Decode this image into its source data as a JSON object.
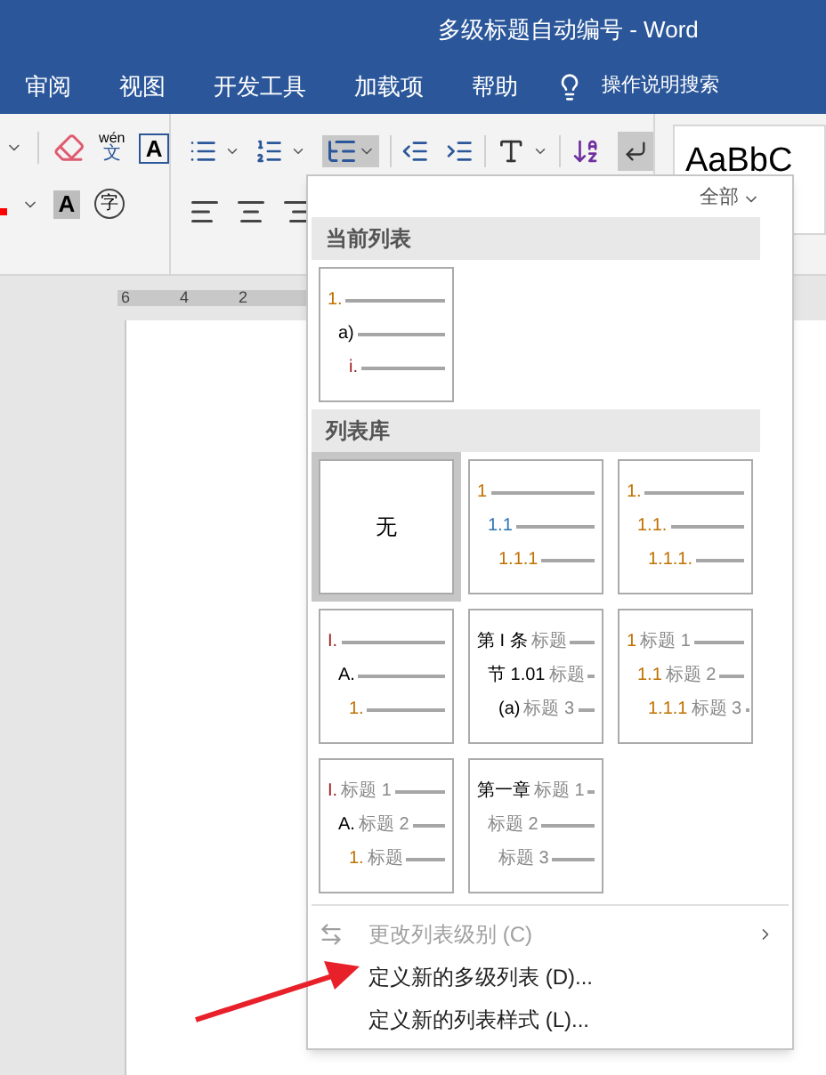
{
  "window": {
    "title": "多级标题自动编号 - Word"
  },
  "tabs": [
    {
      "label": "审阅"
    },
    {
      "label": "视图"
    },
    {
      "label": "开发工具"
    },
    {
      "label": "加载项"
    },
    {
      "label": "帮助"
    }
  ],
  "tell_me": {
    "placeholder": "操作说明搜索"
  },
  "ribbon": {
    "phonetic_top": "wén",
    "phonetic_bottom": "文",
    "border_char": "A",
    "shading_char": "A",
    "enclose_char": "字",
    "multilevel_open": true,
    "show_marks_on": true,
    "style_preview": "AaBbC"
  },
  "ruler": [
    "6",
    "4",
    "2"
  ],
  "menu": {
    "filter": "全部",
    "current_header": "当前列表",
    "current": {
      "levels": [
        {
          "number": "1.",
          "color": "#c07000"
        },
        {
          "number": "a)",
          "color": "#000000"
        },
        {
          "number": "i.",
          "color": "#a02020"
        }
      ]
    },
    "library_header": "列表库",
    "gallery": [
      {
        "kind": "none",
        "text": "无",
        "selected": true
      },
      {
        "kind": "list",
        "selected": false,
        "levels": [
          {
            "number": "1",
            "color": "#c07000"
          },
          {
            "number": "1.1",
            "color": "#2e75b6"
          },
          {
            "number": "1.1.1",
            "color": "#c07000"
          }
        ]
      },
      {
        "kind": "list",
        "selected": false,
        "levels": [
          {
            "number": "1.",
            "color": "#c07000"
          },
          {
            "number": "1.1.",
            "color": "#c07000"
          },
          {
            "number": "1.1.1.",
            "color": "#c07000"
          }
        ]
      },
      {
        "kind": "list",
        "selected": false,
        "levels": [
          {
            "number": "I.",
            "color": "#a02020"
          },
          {
            "number": "A.",
            "color": "#000000"
          },
          {
            "number": "1.",
            "color": "#c07000"
          }
        ]
      },
      {
        "kind": "list",
        "selected": false,
        "levels": [
          {
            "number": "第 I 条",
            "color": "#000000",
            "label": "标题"
          },
          {
            "number": "节 1.01",
            "color": "#000000",
            "label": "标题"
          },
          {
            "number": "(a)",
            "color": "#000000",
            "label": "标题 3"
          }
        ]
      },
      {
        "kind": "list",
        "selected": false,
        "levels": [
          {
            "number": "1",
            "color": "#c07000",
            "label": "标题 1"
          },
          {
            "number": "1.1",
            "color": "#c07000",
            "label": "标题 2"
          },
          {
            "number": "1.1.1",
            "color": "#c07000",
            "label": "标题 3"
          }
        ]
      },
      {
        "kind": "list",
        "selected": false,
        "levels": [
          {
            "number": "I.",
            "color": "#a02020",
            "label": "标题 1"
          },
          {
            "number": "A.",
            "color": "#000000",
            "label": "标题 2"
          },
          {
            "number": "1.",
            "color": "#c07000",
            "label": "标题"
          }
        ]
      },
      {
        "kind": "list",
        "selected": false,
        "levels": [
          {
            "number": "第一章",
            "color": "#000000",
            "label": "标题 1"
          },
          {
            "label": "标题 2"
          },
          {
            "label": "标题 3"
          }
        ]
      }
    ],
    "items": [
      {
        "label": "更改列表级别 (C)",
        "disabled": true,
        "submenu": true
      },
      {
        "label": "定义新的多级列表 (D)...",
        "disabled": false,
        "submenu": false
      },
      {
        "label": "定义新的列表样式 (L)...",
        "disabled": false,
        "submenu": false
      }
    ]
  }
}
